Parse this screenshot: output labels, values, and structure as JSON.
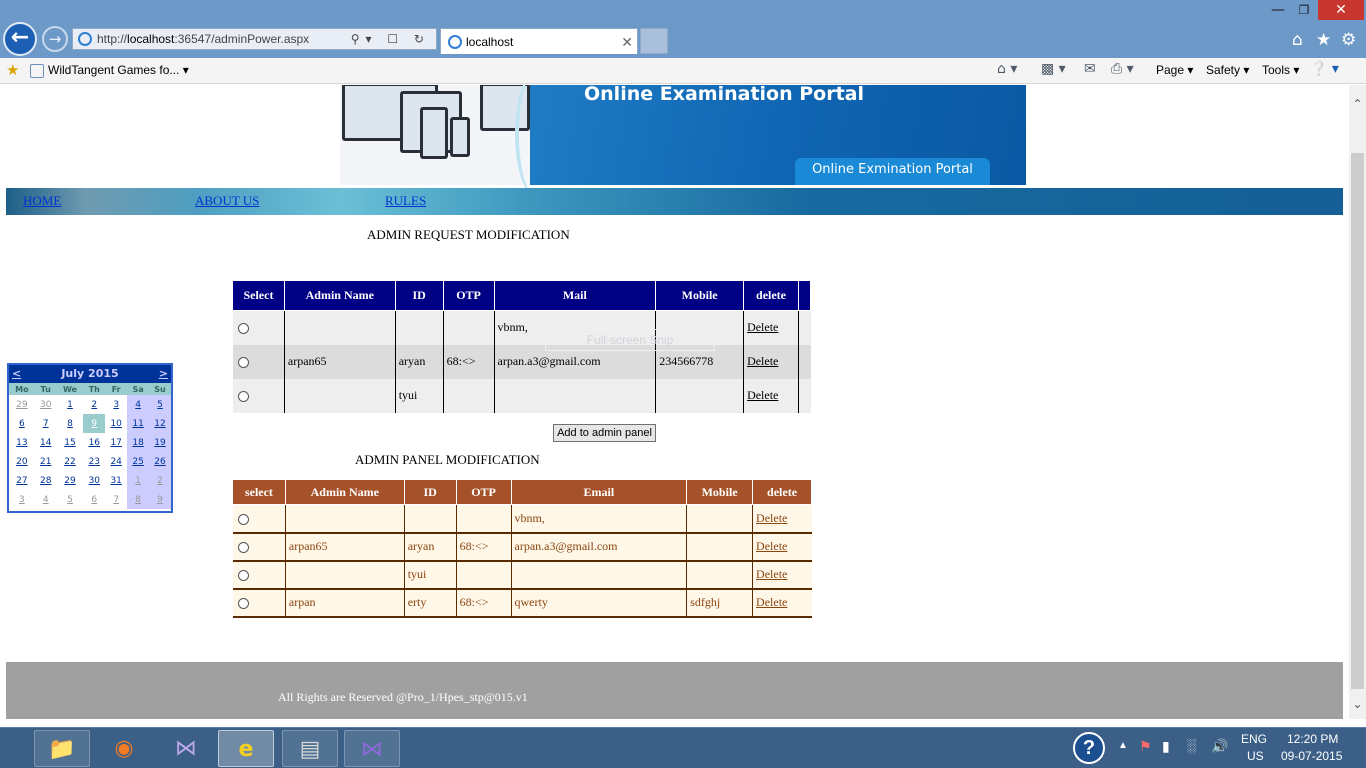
{
  "browser": {
    "url_prefix": "http://",
    "url_host": "localhost",
    "url_path": ":36547/adminPower.aspx",
    "tab_title": "localhost",
    "favorites_link": "WildTangent Games fo...",
    "menu": [
      "Page",
      "Safety",
      "Tools"
    ]
  },
  "banner": {
    "title": "Online Examination Portal",
    "subtitle": "Online Exmination Portal"
  },
  "nav": [
    "HOME",
    "ABOUT US",
    "RULES"
  ],
  "request_section": {
    "title": "ADMIN REQUEST MODIFICATION",
    "headers": [
      "Select",
      "Admin Name",
      "ID",
      "OTP",
      "Mail",
      "Mobile",
      "delete"
    ],
    "rows": [
      {
        "name": "",
        "id": "",
        "otp": "",
        "mail": "vbnm,",
        "mobile": "",
        "action": "Delete"
      },
      {
        "name": "arpan65",
        "id": "aryan",
        "otp": "68:<>",
        "mail": "arpan.a3@gmail.com",
        "mobile": "234566778",
        "action": "Delete"
      },
      {
        "name": "",
        "id": "tyui",
        "otp": "",
        "mail": "",
        "mobile": "",
        "action": "Delete"
      }
    ],
    "button_label": "Add to admin panel",
    "overlay_text": "Full-screen Snip"
  },
  "panel_section": {
    "title": "ADMIN PANEL MODIFICATION",
    "headers": [
      "select",
      "Admin Name",
      "ID",
      "OTP",
      "Email",
      "Mobile",
      "delete"
    ],
    "rows": [
      {
        "name": "",
        "id": "",
        "otp": "",
        "mail": "vbnm,",
        "mobile": "",
        "action": "Delete"
      },
      {
        "name": "arpan65",
        "id": "aryan",
        "otp": "68:<>",
        "mail": "arpan.a3@gmail.com",
        "mobile": "",
        "action": "Delete"
      },
      {
        "name": "",
        "id": "tyui",
        "otp": "",
        "mail": "",
        "mobile": "",
        "action": "Delete"
      },
      {
        "name": "arpan",
        "id": "erty",
        "otp": "68:<>",
        "mail": "qwerty",
        "mobile": "sdfghj",
        "action": "Delete"
      }
    ]
  },
  "calendar": {
    "month_label": "July 2015",
    "prev": "<",
    "next": ">",
    "weekdays": [
      "Mo",
      "Tu",
      "We",
      "Th",
      "Fr",
      "Sa",
      "Su"
    ],
    "weeks": [
      [
        "29",
        "30",
        "1",
        "2",
        "3",
        "4",
        "5"
      ],
      [
        "6",
        "7",
        "8",
        "9",
        "10",
        "11",
        "12"
      ],
      [
        "13",
        "14",
        "15",
        "16",
        "17",
        "18",
        "19"
      ],
      [
        "20",
        "21",
        "22",
        "23",
        "24",
        "25",
        "26"
      ],
      [
        "27",
        "28",
        "29",
        "30",
        "31",
        "1",
        "2"
      ],
      [
        "3",
        "4",
        "5",
        "6",
        "7",
        "8",
        "9"
      ]
    ],
    "selected_day": "9"
  },
  "footer": {
    "text": "All Rights are Reserved @Pro_1/Hpes_stp@015.v1"
  },
  "taskbar": {
    "lang": "ENG",
    "region": "US",
    "time": "12:20 PM",
    "date": "09-07-2015"
  },
  "colors": {
    "request_header": "#000084",
    "panel_header": "#a55129",
    "panel_text": "#8c4510",
    "calendar_header": "#003399",
    "footer": "#a0a0a0"
  }
}
